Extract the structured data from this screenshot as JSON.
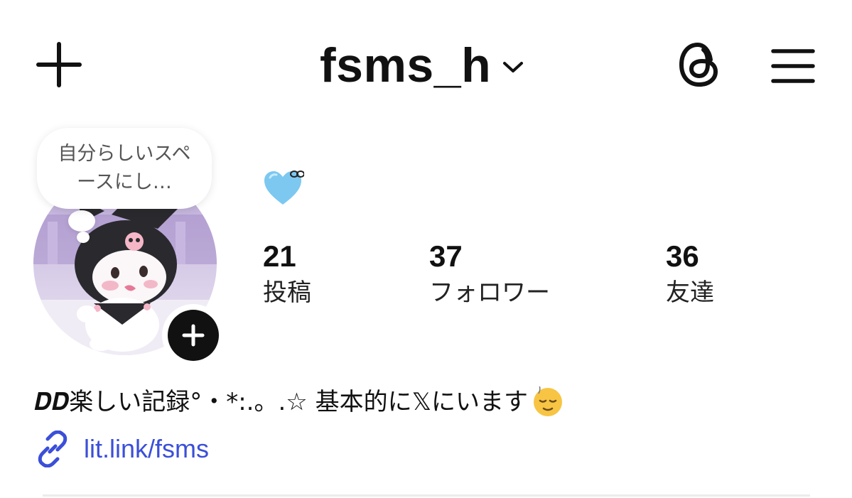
{
  "header": {
    "username": "fsms_h",
    "icons": {
      "create": "plus-icon",
      "switch_account": "chevron-down-icon",
      "threads": "threads-icon",
      "menu": "hamburger-menu-icon"
    }
  },
  "profile": {
    "note": "自分らしいスペースにし…",
    "status_emoji": "light-blue-heart-emoji",
    "avatar": "profile-avatar",
    "add_story_icon": "plus-icon"
  },
  "stats": [
    {
      "value": "21",
      "label": "投稿"
    },
    {
      "value": "37",
      "label": "フォロワー"
    },
    {
      "value": "36",
      "label": "友達"
    }
  ],
  "bio": {
    "text": "𝑫𝑫楽しい記録°・*:.。.☆ 基本的に𝕏にいます",
    "emoji": "relieved-face-emoji"
  },
  "link": {
    "text": "lit.link/fsms",
    "icon": "link-icon"
  },
  "colors": {
    "text": "#111111",
    "link": "#3b4fd8",
    "heart": "#7cc8f0",
    "note_text": "#555555"
  }
}
